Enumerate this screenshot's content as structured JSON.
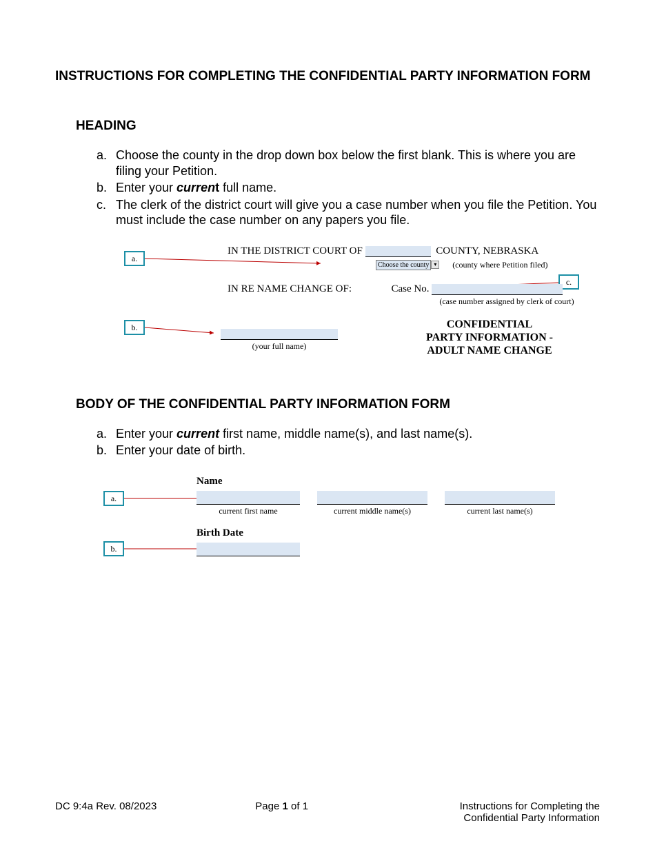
{
  "title": "INSTRUCTIONS FOR COMPLETING THE CONFIDENTIAL PARTY INFORMATION FORM",
  "heading": {
    "label": "HEADING",
    "items": {
      "a": {
        "marker": "a.",
        "text": "Choose the county in the drop down box below the first blank. This is where you are filing your Petition."
      },
      "b": {
        "marker": "b.",
        "prefix": "Enter your ",
        "bolditalic": "curren",
        "boldtail": "t",
        "suffix": " full name."
      },
      "c": {
        "marker": "c.",
        "text": "The clerk of the district court will give you a case number when you file the Petition. You must include the case number on any papers you file."
      }
    },
    "example": {
      "callouts": {
        "a": "a.",
        "b": "b.",
        "c": "c."
      },
      "line1_before": "IN THE DISTRICT COURT OF",
      "line1_after": "COUNTY, NEBRASKA",
      "dropdown_label": "Choose the county",
      "line1_sub": "(county where Petition filed)",
      "line2_label": "IN RE NAME CHANGE OF:",
      "case_label": "Case No.",
      "case_sub": "(case number assigned by clerk of court)",
      "name_sub": "(your full name)",
      "big1": "CONFIDENTIAL",
      "big2": "PARTY INFORMATION -",
      "big3": "ADULT NAME CHANGE"
    }
  },
  "body": {
    "label": "BODY OF THE CONFIDENTIAL PARTY INFORMATION FORM",
    "items": {
      "a": {
        "marker": "a.",
        "prefix": "Enter your ",
        "bolditalic": "current",
        "suffix": " first name, middle name(s), and last name(s)."
      },
      "b": {
        "marker": "b.",
        "text": "Enter your date of birth."
      }
    },
    "example": {
      "callouts": {
        "a": "a.",
        "b": "b."
      },
      "name_label": "Name",
      "fn": "current first name",
      "mn": "current middle name(s)",
      "ln": "current last name(s)",
      "birth_label": "Birth Date"
    }
  },
  "footer": {
    "left": "DC 9:4a Rev. 08/2023",
    "mid_before": "Page ",
    "mid_page": "1",
    "mid_of": " of ",
    "mid_total": "1",
    "right": "Instructions for Completing the Confidential Party Information"
  }
}
